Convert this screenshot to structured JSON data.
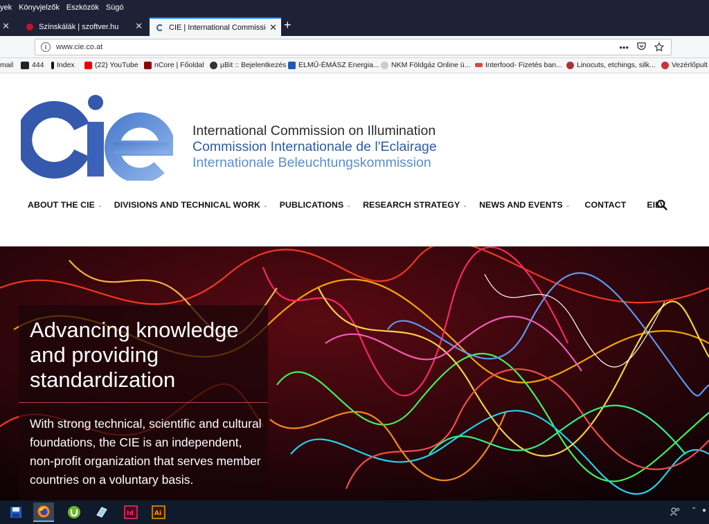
{
  "menu": [
    "yek",
    "Könyvjelzők",
    "Eszközök",
    "Súgó"
  ],
  "tabs": [
    {
      "label": "Színskálák | szoftver.hu",
      "active": false
    },
    {
      "label": "CIE | International Commission",
      "active": true
    }
  ],
  "address": {
    "url": "www.cie.co.at"
  },
  "bookmarks": [
    "mail",
    "444",
    "Index",
    "(22) YouTube",
    "nCore | Főoldal",
    "µBit :: Bejelentkezés",
    "ELMŰ-ÉMÁSZ Energia...",
    "NKM Földgáz Online ü...",
    "Interfood- Fizetés ban...",
    "Linocuts, etchings, silk...",
    "Vezérlőpult"
  ],
  "site": {
    "tagline": [
      "International Commission on Illumination",
      "Commission Internationale de l'Eclairage",
      "Internationale Beleuchtungskommission"
    ],
    "nav": [
      {
        "label": "ABOUT THE CIE",
        "dropdown": true
      },
      {
        "label": "DIVISIONS AND TECHNICAL WORK",
        "dropdown": true
      },
      {
        "label": "PUBLICATIONS",
        "dropdown": true
      },
      {
        "label": "RESEARCH STRATEGY",
        "dropdown": true
      },
      {
        "label": "NEWS AND EVENTS",
        "dropdown": true
      },
      {
        "label": "CONTACT",
        "dropdown": false
      },
      {
        "label": "EILV",
        "dropdown": false
      }
    ]
  },
  "hero": {
    "title": "Advancing knowledge and providing standardization",
    "body": "With strong technical, scientific and cultural foundations, the CIE is an independent, non-profit organization that serves member countries on a voluntary basis."
  },
  "colors": {
    "logo_dark": "#3559ad",
    "logo_light": "#6a97da",
    "browser_chrome": "#1f2236",
    "accent_tab": "#0a84ff"
  },
  "taskbar": [
    "save-icon",
    "firefox-icon",
    "utorrent-icon",
    "notepad-icon",
    "indesign-icon",
    "illustrator-icon"
  ]
}
